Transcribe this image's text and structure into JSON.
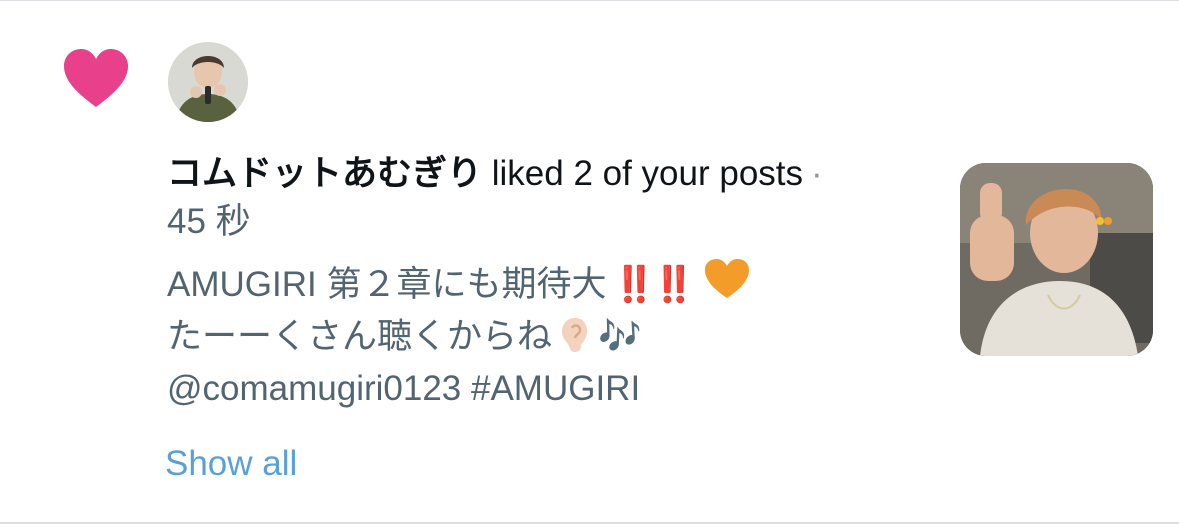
{
  "notification": {
    "type_icon": "heart-icon",
    "type_color": "#e8408a",
    "avatar_alt": "コムドットあむぎり",
    "user_name": "コムドットあむぎり",
    "action": " liked 2 of your posts",
    "separator": "·",
    "timestamp": "45 秒",
    "post": {
      "line1_text": "AMUGIRI 第２章にも期待大",
      "line1_emoji_bangs": "‼️‼️",
      "line1_emoji_heart": "orange-heart-icon",
      "line2_text": "たーーくさん聴くからね",
      "line2_emoji_ear": "ear-icon",
      "line2_emoji_notes": "🎶",
      "line3_text": "@comamugiri0123 #AMUGIRI"
    },
    "show_all_label": "Show all",
    "thumbnail": "post-thumbnail"
  },
  "colors": {
    "link": "#5aa0d8",
    "muted_text": "#536471",
    "primary_text": "#0f1419",
    "divider": "#dadde1"
  }
}
